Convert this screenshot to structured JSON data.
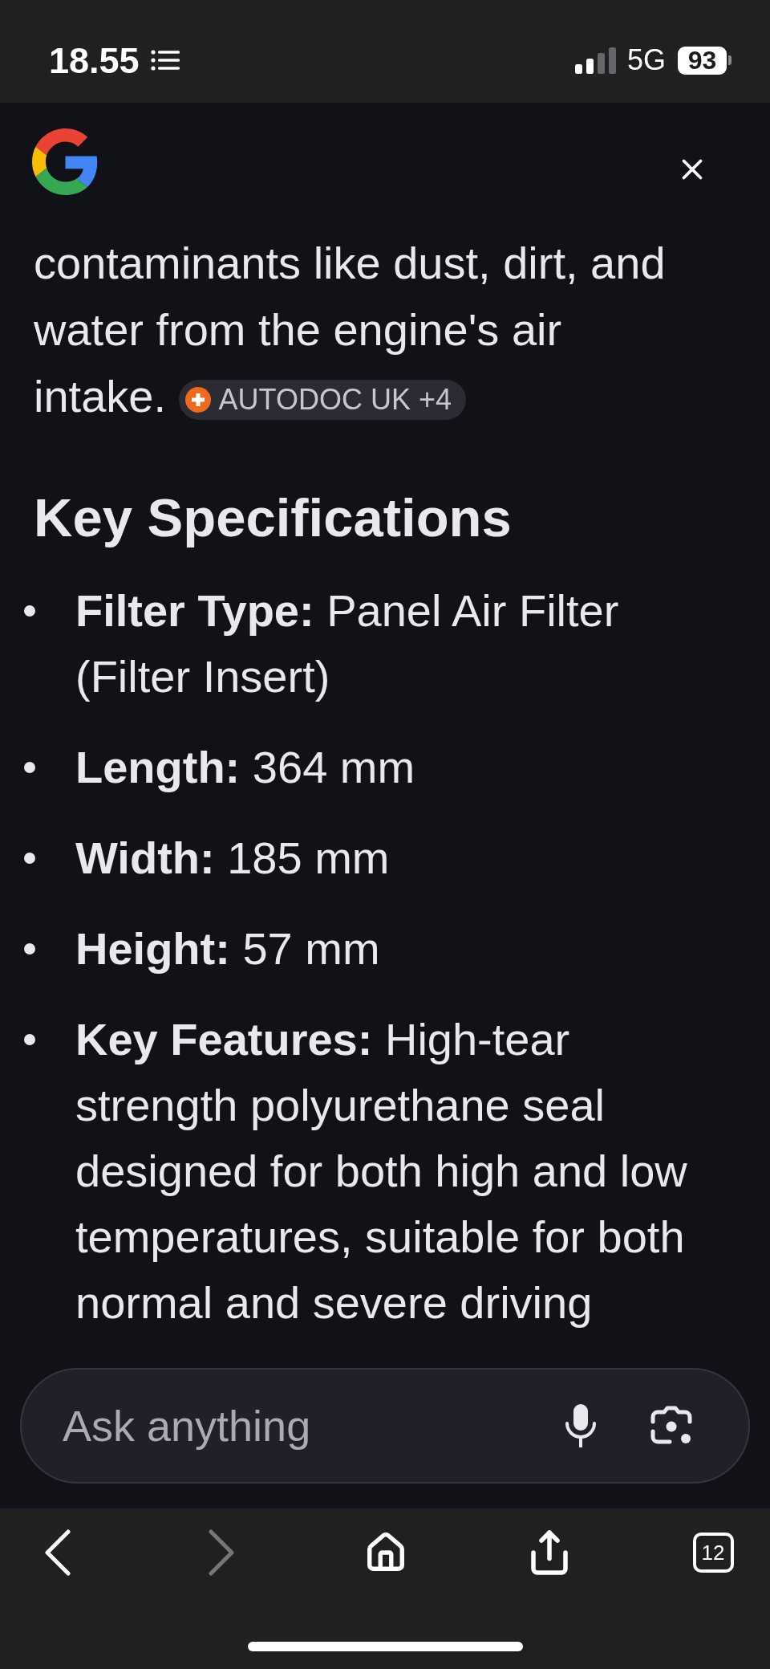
{
  "status_bar": {
    "time": "18.55",
    "network": "5G",
    "battery": "93"
  },
  "answer": {
    "text": "contaminants like dust, dirt, and water from the engine's air intake.",
    "source_chip": "AUTODOC UK +4"
  },
  "specifications": {
    "heading": "Key Specifications",
    "items": [
      "**Filter Type:** Panel Air Filter (Filter Insert)",
      "**Length:** 364 mm",
      "**Width:** 185 mm",
      "**Height:** 57 mm",
      "**Key Features:** High-tear strength polyurethane seal designed for both high and low temperatures, suitable for both normal and severe driving"
    ]
  },
  "search": {
    "placeholder": "Ask anything"
  },
  "toolbar": {
    "back": {
      "disabled": false
    },
    "forward": {
      "disabled": true
    },
    "tab_count": "12"
  }
}
